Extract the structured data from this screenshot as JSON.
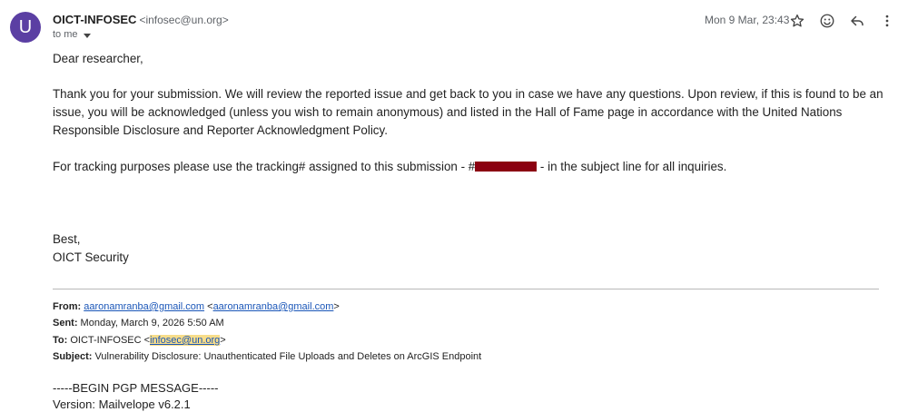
{
  "header": {
    "avatar_letter": "U",
    "sender_name": "OICT-INFOSEC",
    "sender_address": "<infosec@un.org>",
    "to_label": "to me",
    "date": "Mon 9 Mar, 23:43"
  },
  "toolbar": {
    "star_icon": "star-icon",
    "emoji_icon": "smiley-icon",
    "reply_icon": "reply-icon",
    "more_icon": "more-vert-icon"
  },
  "body": {
    "greeting": "Dear researcher,",
    "paragraph1": "Thank you for your submission. We will review the reported issue and get back to you in case we have any questions. Upon review, if this is found to be an issue, you will be acknowledged (unless you wish to remain anonymous) and listed in the Hall of Fame page in accordance with the United Nations Responsible Disclosure and Reporter Acknowledgment Policy.",
    "tracking_before": "For tracking purposes please use the tracking# assigned to this submission - #",
    "tracking_after": " - in the subject line for all inquiries.",
    "closing": "Best,",
    "signature": "OICT Security"
  },
  "quoted": {
    "from_label": "From:",
    "from_link": "aaronamranba@gmail.com",
    "from_angle_open": " <",
    "from_email": "aaronamranba@gmail.com",
    "from_angle_close": ">",
    "sent_label": "Sent:",
    "sent_value": " Monday, March 9, 2026 5:50 AM",
    "to_label": "To:",
    "to_value": " OICT-INFOSEC <",
    "to_email": "infosec@un.org",
    "to_close": ">",
    "subject_label": "Subject:",
    "subject_value": " Vulnerability Disclosure: Unauthenticated File Uploads and Deletes on ArcGIS Endpoint"
  },
  "pgp": {
    "begin": "-----BEGIN PGP MESSAGE-----",
    "version": "Version: Mailvelope v6.2.1"
  },
  "colors": {
    "avatar_bg": "#5b3fa3",
    "link": "#1a56b8",
    "highlight": "#f7dd8a",
    "redaction": "#8b0011"
  }
}
